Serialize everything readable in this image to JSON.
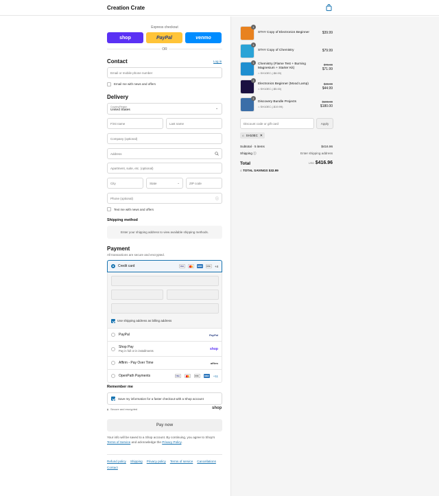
{
  "header": {
    "brand": "Creation Crate"
  },
  "express": {
    "title": "Express checkout",
    "shop": "shop",
    "paypal": "PayPal",
    "venmo": "venmo",
    "or": "OR"
  },
  "contact": {
    "heading": "Contact",
    "login": "Log in",
    "email_placeholder": "Email or mobile phone number",
    "news_label": "Email me with news and offers"
  },
  "delivery": {
    "heading": "Delivery",
    "country_label": "Country/Region",
    "country_value": "United States",
    "first_name": "First name",
    "last_name": "Last name",
    "company": "Company (optional)",
    "address": "Address",
    "apartment": "Apartment, suite, etc. (optional)",
    "city": "City",
    "state": "State",
    "zip": "ZIP code",
    "phone": "Phone (optional)",
    "text_label": "Text me with news and offers"
  },
  "shipping": {
    "heading": "Shipping method",
    "note": "Enter your shipping address to view available shipping methods."
  },
  "payment": {
    "heading": "Payment",
    "subtitle": "All transactions are secure and encrypted.",
    "credit_card": "Credit card",
    "more_cards": "+4",
    "billing_label": "Use shipping address as billing address",
    "paypal": "PayPal",
    "paypal_logo": "PayPal",
    "shoppay": "Shop Pay",
    "shoppay_sub": "Pay in full or in installments",
    "shoppay_logo": "shop",
    "affirm": "Affirm - Pay Over Time",
    "affirm_logo": "affirm",
    "openpath": "OpenPath Payments",
    "openpath_more": "+11"
  },
  "remember": {
    "heading": "Remember me",
    "label": "Save my information for a faster checkout with a Shop account",
    "secure": "Secure and encrypted",
    "shop_logo": "shop"
  },
  "pay_now": "Pay now",
  "legal": {
    "text1": "Your info will be saved to a Shop account. By continuing, you agree to Shop's",
    "terms": "Terms of Service",
    "text2": "and acknowledge the",
    "privacy": "Privacy Policy",
    "end": "."
  },
  "footer": {
    "links": [
      "Refund policy",
      "Shipping",
      "Privacy policy",
      "Terms of service",
      "Cancellations",
      "Contact"
    ]
  },
  "order": {
    "items": [
      {
        "qty": "1",
        "title": "STAY Copy of Electronics Beginner",
        "discount": "",
        "old_price": "",
        "price": "$39.99",
        "color": "#e8821f"
      },
      {
        "qty": "1",
        "title": "STAY Copy of Chemistry",
        "discount": "",
        "old_price": "",
        "price": "$79.99",
        "color": "#2ba3d6"
      },
      {
        "qty": "1",
        "title": "Chemistry (Flame Test + Burning Magnesium + Starter Kit)",
        "discount": "SH10EC (-$8.00)",
        "old_price": "$79.99",
        "price": "$71.99",
        "color": "#1f8fd0"
      },
      {
        "qty": "1",
        "title": "Electronics Beginner (Mood Lamp)",
        "discount": "SH10EC (-$5.00)",
        "old_price": "$49.99",
        "price": "$44.99",
        "color": "#1a1040"
      },
      {
        "qty": "1",
        "title": "Discovery Bundle Projects",
        "discount": "SH10EC (-$19.99)",
        "old_price": "$199.99",
        "price": "$180.00",
        "color": "#3a6ea8"
      }
    ],
    "discount_placeholder": "Discount code or gift card",
    "apply": "Apply",
    "code_tag": "SH10EC",
    "subtotal_label": "Subtotal · 5 items",
    "subtotal": "$416.96",
    "shipping_label": "Shipping",
    "shipping_value": "Enter shipping address",
    "total_label": "Total",
    "currency": "USD",
    "total": "$416.96",
    "savings_label": "TOTAL SAVINGS",
    "savings": "$32.99"
  },
  "colors": {
    "accent": "#1773b0",
    "shop": "#5a31f4",
    "paypal": "#ffc439",
    "venmo": "#008cff"
  }
}
